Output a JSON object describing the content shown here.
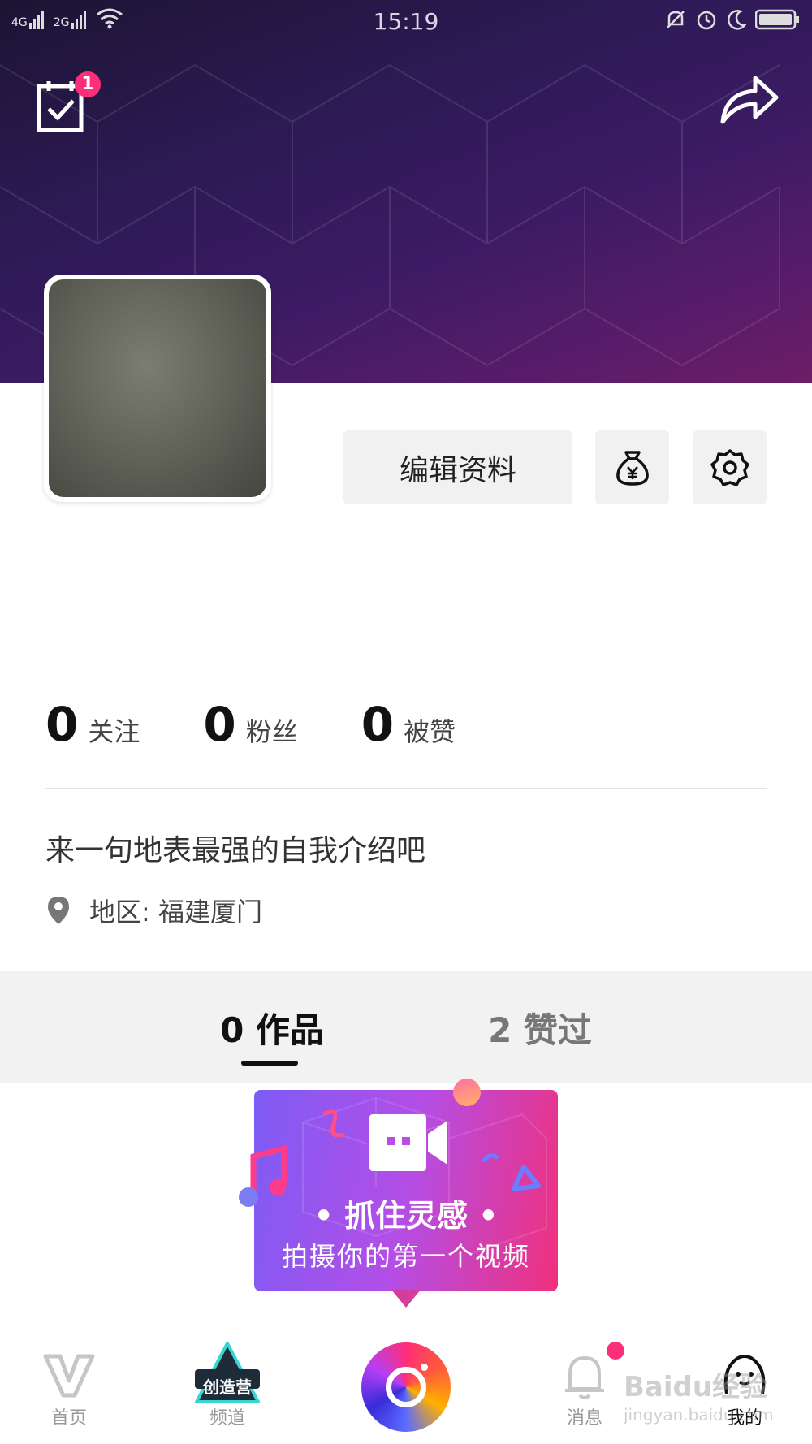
{
  "status_bar": {
    "network_1": "4G",
    "network_2": "2G",
    "time": "15:19"
  },
  "header": {
    "task_badge_count": "1"
  },
  "profile": {
    "edit_button_label": "编辑资料",
    "bio": "来一句地表最强的自我介绍吧",
    "location": "地区: 福建厦门"
  },
  "stats": [
    {
      "value": "0",
      "label": "关注"
    },
    {
      "value": "0",
      "label": "粉丝"
    },
    {
      "value": "0",
      "label": "被赞"
    }
  ],
  "tabs": {
    "works": "0 作品",
    "likes": "2 赞过"
  },
  "promo": {
    "title": "• 抓住灵感 •",
    "subtitle": "拍摄你的第一个视频"
  },
  "nav": {
    "home": "首页",
    "channel": "频道",
    "channel_logo": "创造营",
    "messages": "消息",
    "me": "我的"
  },
  "watermark": {
    "main": "Baidu经验",
    "sub": "jingyan.baidu.com"
  },
  "colors": {
    "accent": "#ff2e79",
    "header_dark": "#2d1a55",
    "header_light": "#6d1d66"
  }
}
